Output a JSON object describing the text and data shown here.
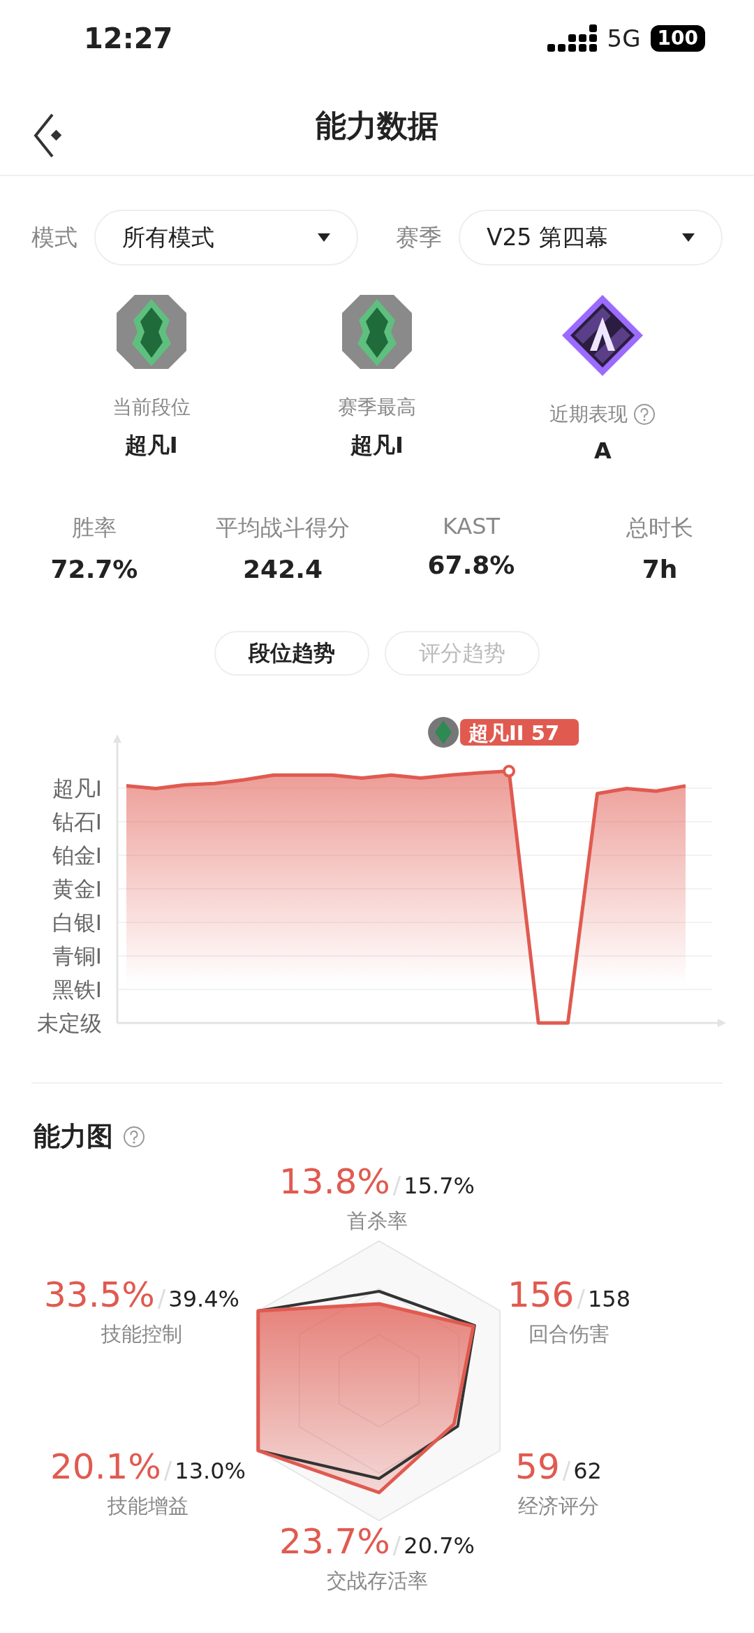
{
  "status_bar": {
    "time": "12:27",
    "network": "5G",
    "battery": "100"
  },
  "header": {
    "title": "能力数据"
  },
  "filters": [
    {
      "label": "模式",
      "value": "所有模式"
    },
    {
      "label": "赛季",
      "value": "V25 第四幕"
    }
  ],
  "ranks": [
    {
      "kind": "rank",
      "label": "当前段位",
      "value": "超凡I"
    },
    {
      "kind": "rank",
      "label": "赛季最高",
      "value": "超凡I"
    },
    {
      "kind": "grade",
      "label": "近期表现",
      "value": "A",
      "help": true
    }
  ],
  "stats": [
    {
      "label": "胜率",
      "value": "72.7%"
    },
    {
      "label": "平均战斗得分",
      "value": "242.4"
    },
    {
      "label": "KAST",
      "value": "67.8%"
    },
    {
      "label": "总时长",
      "value": "7h"
    }
  ],
  "trend_tabs": [
    {
      "label": "段位趋势",
      "selected": true
    },
    {
      "label": "评分趋势",
      "selected": false
    }
  ],
  "trend_chart": {
    "y_labels": [
      "超凡I",
      "钻石I",
      "铂金I",
      "黄金I",
      "白银I",
      "青铜I",
      "黑铁I",
      "未定级"
    ],
    "tooltip": "超凡II 57"
  },
  "ability": {
    "title": "能力图",
    "help": true,
    "axes": [
      {
        "value": "13.8%",
        "separator": "/",
        "average": "15.7%",
        "label": "首杀率"
      },
      {
        "value": "33.5%",
        "separator": "/",
        "average": "39.4%",
        "label": "技能控制"
      },
      {
        "value": "156",
        "separator": "/",
        "average": "158",
        "label": "回合伤害"
      },
      {
        "value": "20.1%",
        "separator": "/",
        "average": "13.0%",
        "label": "技能增益"
      },
      {
        "value": "59",
        "separator": "/",
        "average": "62",
        "label": "经济评分"
      },
      {
        "value": "23.7%",
        "separator": "/",
        "average": "20.7%",
        "label": "交战存活率"
      }
    ]
  }
}
